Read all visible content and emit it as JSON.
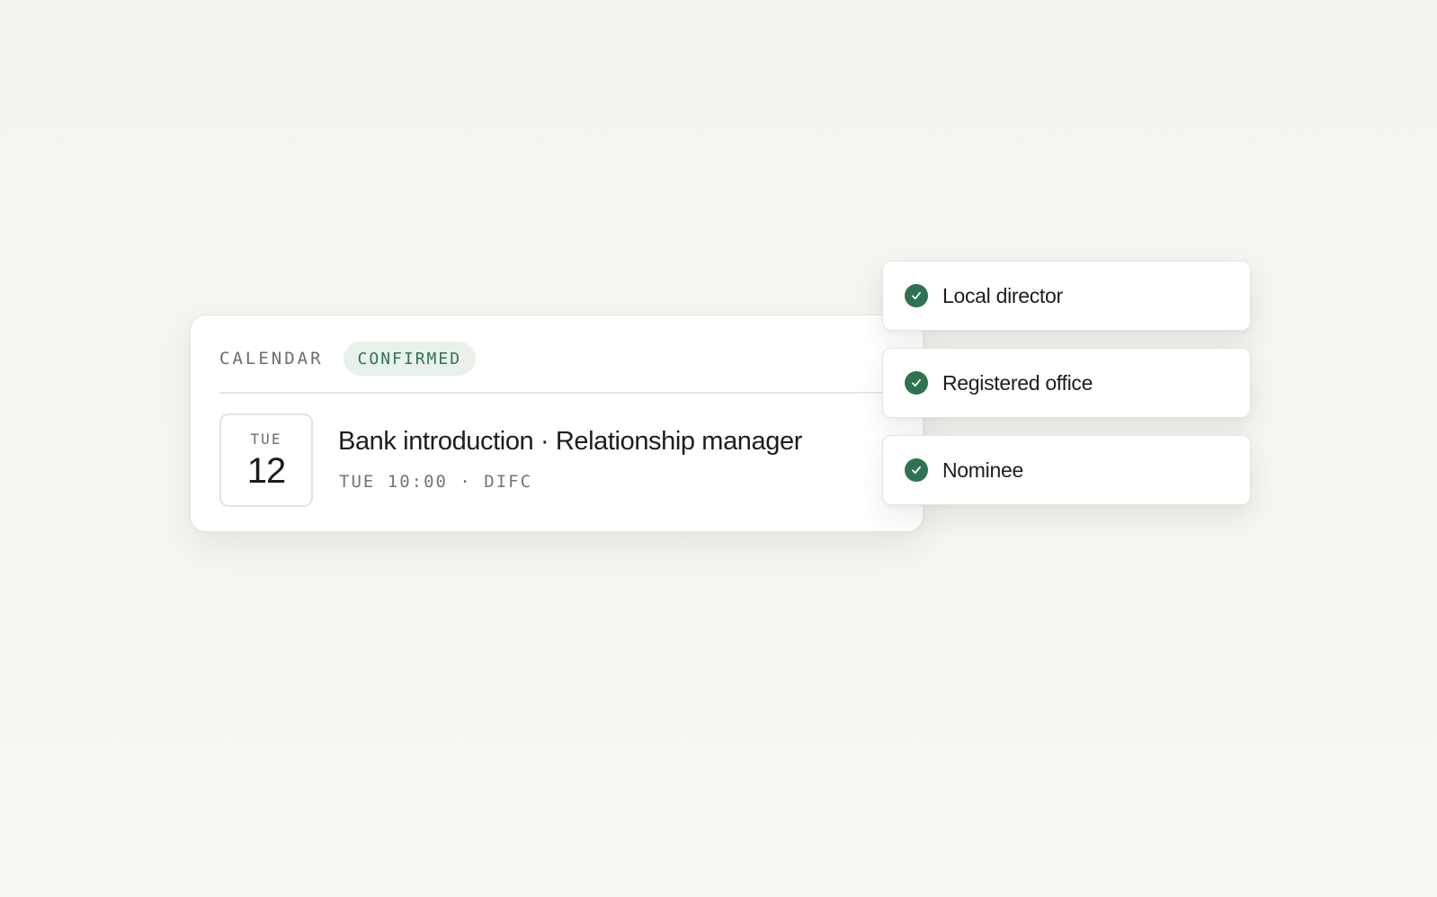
{
  "calendar_card": {
    "kicker": "CALENDAR",
    "status": "CONFIRMED",
    "date": {
      "weekday": "TUE",
      "day": "12"
    },
    "event_title": "Bank introduction · Relationship manager",
    "event_meta": "TUE 10:00 · DIFC"
  },
  "checklist": {
    "items": [
      {
        "label": "Local director",
        "icon": "check-circle-icon"
      },
      {
        "label": "Registered office",
        "icon": "check-circle-icon"
      },
      {
        "label": "Nominee",
        "icon": "check-circle-icon"
      }
    ]
  },
  "colors": {
    "background": "#f5f4f0",
    "accent_green": "#2e7350",
    "badge_bg": "#e9f1ea",
    "text_primary": "#1d1d1b",
    "text_muted": "#6f6d68"
  }
}
